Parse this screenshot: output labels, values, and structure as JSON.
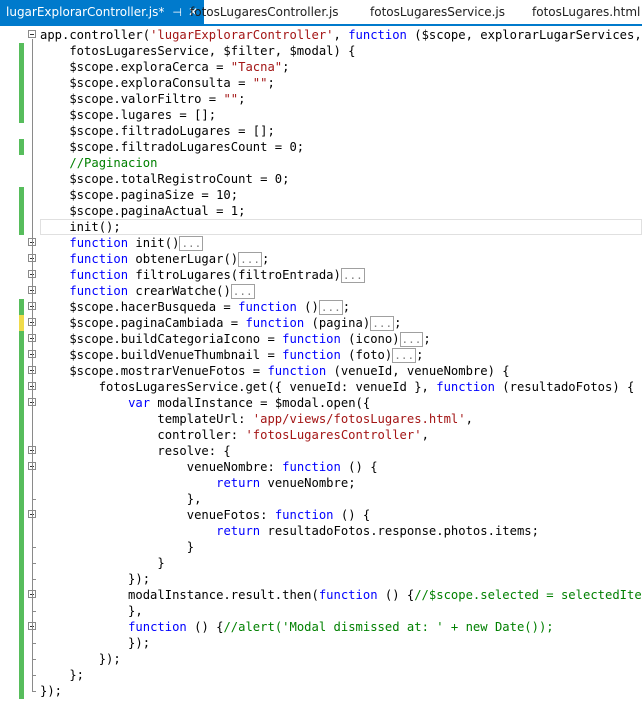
{
  "tabs": [
    {
      "label": "lugarExplorarController.js*",
      "pin": "⊣",
      "close": "✕"
    },
    {
      "label": "fotosLugaresController.js"
    },
    {
      "label": "fotosLugaresService.js"
    },
    {
      "label": "fotosLugares.html"
    }
  ],
  "colors": {
    "accent": "#007acc",
    "keyword": "#0000ff",
    "string": "#a31515",
    "comment": "#008000",
    "changed": "#57bd5c",
    "modified": "#efdb4b"
  },
  "code": [
    {
      "t": "app.controller('lugarExplorarController', function ($scope, explorarLugarServices,"
    },
    {
      "t": "    fotosLugaresService, $filter, $modal) {"
    },
    {
      "t": "    $scope.exploraCerca = \"Tacna\";"
    },
    {
      "t": "    $scope.exploraConsulta = \"\";"
    },
    {
      "t": "    $scope.valorFiltro = \"\";"
    },
    {
      "t": "    $scope.lugares = [];"
    },
    {
      "t": "    $scope.filtradoLugares = [];"
    },
    {
      "t": "    $scope.filtradoLugaresCount = 0;"
    },
    {
      "t": "    //Paginacion"
    },
    {
      "t": "    $scope.totalRegistroCount = 0;"
    },
    {
      "t": "    $scope.paginaSize = 10;"
    },
    {
      "t": "    $scope.paginaActual = 1;"
    },
    {
      "t": "    init();"
    },
    {
      "t": "    function init()..."
    },
    {
      "t": "    function obtenerLugar()...;"
    },
    {
      "t": "    function filtroLugares(filtroEntrada)..."
    },
    {
      "t": "    function crearWatche()..."
    },
    {
      "t": "    $scope.hacerBusqueda = function ()...;"
    },
    {
      "t": "    $scope.paginaCambiada = function (pagina)...;"
    },
    {
      "t": "    $scope.buildCategoriaIcono = function (icono)...;"
    },
    {
      "t": "    $scope.buildVenueThumbnail = function (foto)...;"
    },
    {
      "t": "    $scope.mostrarVenueFotos = function (venueId, venueNombre) {"
    },
    {
      "t": "        fotosLugaresService.get({ venueId: venueId }, function (resultadoFotos) {"
    },
    {
      "t": "            var modalInstance = $modal.open({"
    },
    {
      "t": "                templateUrl: 'app/views/fotosLugares.html',"
    },
    {
      "t": "                controller: 'fotosLugaresController',"
    },
    {
      "t": "                resolve: {"
    },
    {
      "t": "                    venueNombre: function () {"
    },
    {
      "t": "                        return venueNombre;"
    },
    {
      "t": "                    },"
    },
    {
      "t": "                    venueFotos: function () {"
    },
    {
      "t": "                        return resultadoFotos.response.photos.items;"
    },
    {
      "t": "                    }"
    },
    {
      "t": "                }"
    },
    {
      "t": "            });"
    },
    {
      "t": "            modalInstance.result.then(function () {//$scope.selected = selectedItem;"
    },
    {
      "t": "            },"
    },
    {
      "t": "            function () {//alert('Modal dismissed at: ' + new Date());"
    },
    {
      "t": "            });"
    },
    {
      "t": "        });"
    },
    {
      "t": "    };"
    },
    {
      "t": "});"
    }
  ]
}
